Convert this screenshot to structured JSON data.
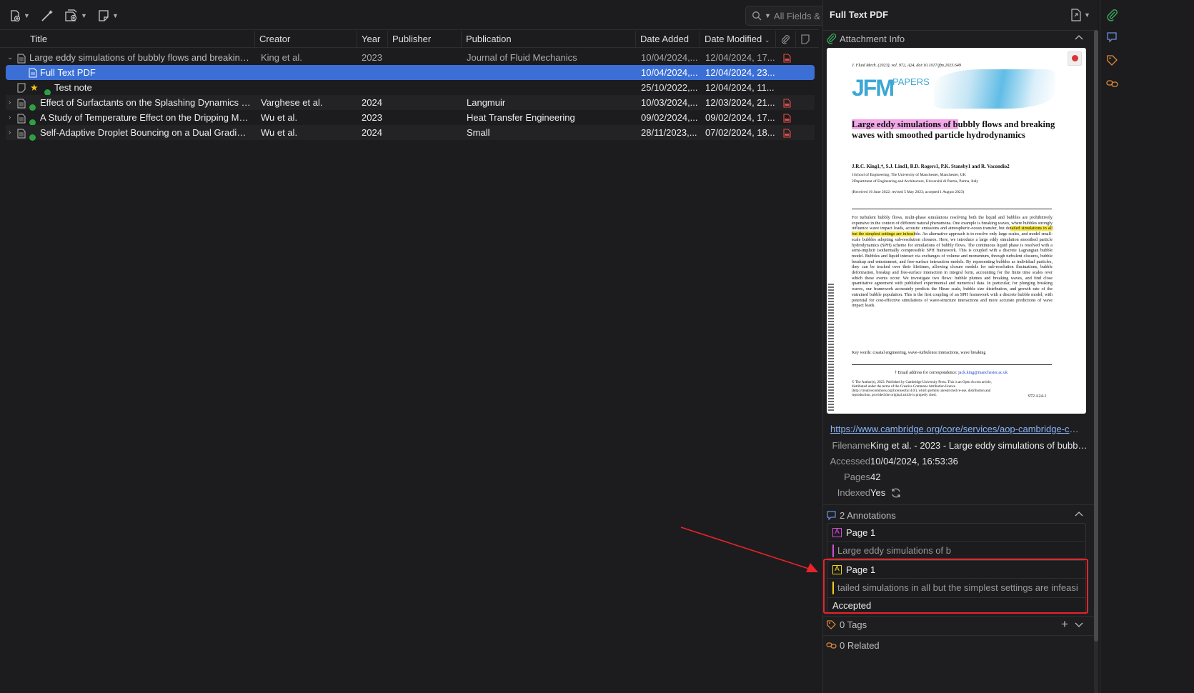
{
  "toolbar": {
    "search_placeholder": "All Fields & Tags"
  },
  "columns": {
    "title": "Title",
    "creator": "Creator",
    "year": "Year",
    "publisher": "Publisher",
    "publication": "Publication",
    "date_added": "Date Added",
    "date_modified": "Date Modified"
  },
  "items": [
    {
      "title": "Large eddy simulations of bubbly flows and breaking ...",
      "creator": "King et al.",
      "year": "2023",
      "publisher": "",
      "publication": "Journal of Fluid Mechanics",
      "date_added": "10/04/2024,...",
      "date_modified": "12/04/2024, 17..."
    },
    {
      "title": "Full Text PDF",
      "creator": "",
      "year": "",
      "publisher": "",
      "publication": "",
      "date_added": "10/04/2024,...",
      "date_modified": "12/04/2024, 23..."
    },
    {
      "title": "Test note",
      "creator": "",
      "year": "",
      "publisher": "",
      "publication": "",
      "date_added": "25/10/2022,...",
      "date_modified": "12/04/2024, 11..."
    },
    {
      "title": "Effect of Surfactants on the Splashing Dynamics of ...",
      "creator": "Varghese et al.",
      "year": "2024",
      "publisher": "",
      "publication": "Langmuir",
      "date_added": "10/03/2024,...",
      "date_modified": "12/03/2024, 21..."
    },
    {
      "title": "A Study of Temperature Effect on the Dripping Mod...",
      "creator": "Wu et al.",
      "year": "2023",
      "publisher": "",
      "publication": "Heat Transfer Engineering",
      "date_added": "09/02/2024,...",
      "date_modified": "09/02/2024, 17..."
    },
    {
      "title": "Self-Adaptive Droplet Bouncing on a Dual Gradient ...",
      "creator": "Wu et al.",
      "year": "2024",
      "publisher": "",
      "publication": "Small",
      "date_added": "28/11/2023,...",
      "date_modified": "07/02/2024, 18..."
    }
  ],
  "right_pane": {
    "title": "Full Text PDF",
    "attachment_info_label": "Attachment Info",
    "preview": {
      "journal_line": "J. Fluid Mech. (2023), vol. 972, A24, doi:10.1017/jfm.2023.649",
      "logo": "JFM",
      "papers": "PAPERS",
      "title_highlighted": "Large eddy simulations of b",
      "title_rest": "ubbly flows and breaking waves with smoothed particle hydrodynamics",
      "authors": "J.R.C. King1,†, S.J. Lind1, B.D. Rogers1, P.K. Stansby1 and R. Vacondio2",
      "aff1": "1School of Engineering, The University of Manchester, Manchester, UK",
      "aff2": "2Department of Engineering and Architecture, Università di Parma, Parma, Italy",
      "received": "(Received 16 June 2022; revised 5 May 2023; accepted 1 August 2023)",
      "abstract_pre": "For turbulent bubbly flows, multi-phase simulations resolving both the liquid and bubbles are prohibitively expensive in the context of different natural phenomena. One example is breaking waves, where bubbles strongly influence wave impact loads, acoustic emissions and atmospheric-ocean transfer, but de",
      "abstract_hl": "tailed simulations in all but the simplest settings are infeasi",
      "abstract_post": "ble. An alternative approach is to resolve only large scales, and model small-scale bubbles adopting sub-resolution closures. Here, we introduce a large eddy simulation smoothed particle hydrodynamics (SPH) scheme for simulations of bubbly flows. The continuous liquid phase is resolved with a semi-implicit isothermally compressible SPH framework. This is coupled with a discrete Lagrangian bubble model. Bubbles and liquid interact via exchanges of volume and momentum, through turbulent closures, bubble breakup and entrainment, and free-surface interaction models. By representing bubbles as individual particles, they can be tracked over their lifetimes, allowing closure models for sub-resolution fluctuations, bubble deformation, breakup and free-surface interaction in integral form, accounting for the finite time scales over which these events occur. We investigate two flows: bubble plumes and breaking waves, and find close quantitative agreement with published experimental and numerical data. In particular, for plunging breaking waves, our framework accurately predicts the Hinze scale, bubble size distribution, and growth rate of the entrained bubble population. This is the first coupling of an SPH framework with a discrete bubble model, with potential for cost-effective simulations of wave-structure interactions and more accurate predictions of wave impact loads.",
      "keywords": "Key words: coastal engineering, wave–turbulence interactions, wave breaking",
      "email_label": "† Email address for correspondence: ",
      "email": "jack.king@manchester.ac.uk",
      "footer": "© The Author(s), 2023. Published by Cambridge University Press. This is an Open Access article, distributed under the terms of the Creative Commons Attribution licence (http://creativecommons.org/licenses/by/4.0/), which permits unrestricted re-use, distribution and reproduction, provided the original article is properly cited.",
      "page_number": "972 A24-1"
    },
    "url": "https://www.cambridge.org/core/services/aop-cambridge-cor...",
    "fields": [
      {
        "label": "Filename",
        "value": "King et al. - 2023 - Large eddy simulations of bubbly..."
      },
      {
        "label": "Accessed",
        "value": "10/04/2024, 16:53:36"
      },
      {
        "label": "Pages",
        "value": "42"
      },
      {
        "label": "Indexed",
        "value": "Yes"
      }
    ],
    "annotations_label": "2 Annotations",
    "annotations": [
      {
        "page": "Page 1",
        "text": "Large eddy simulations of b",
        "color": "#d14fd6",
        "comment": ""
      },
      {
        "page": "Page 1",
        "text": "tailed simulations in all but the simplest settings are infeasi",
        "color": "#f2d21b",
        "comment": "Accepted"
      }
    ],
    "tags_label": "0 Tags",
    "related_label": "0 Related"
  },
  "colors": {
    "selection": "#3b6fd6",
    "accent_green": "#2ea043",
    "highlight_red": "#e8232a"
  }
}
